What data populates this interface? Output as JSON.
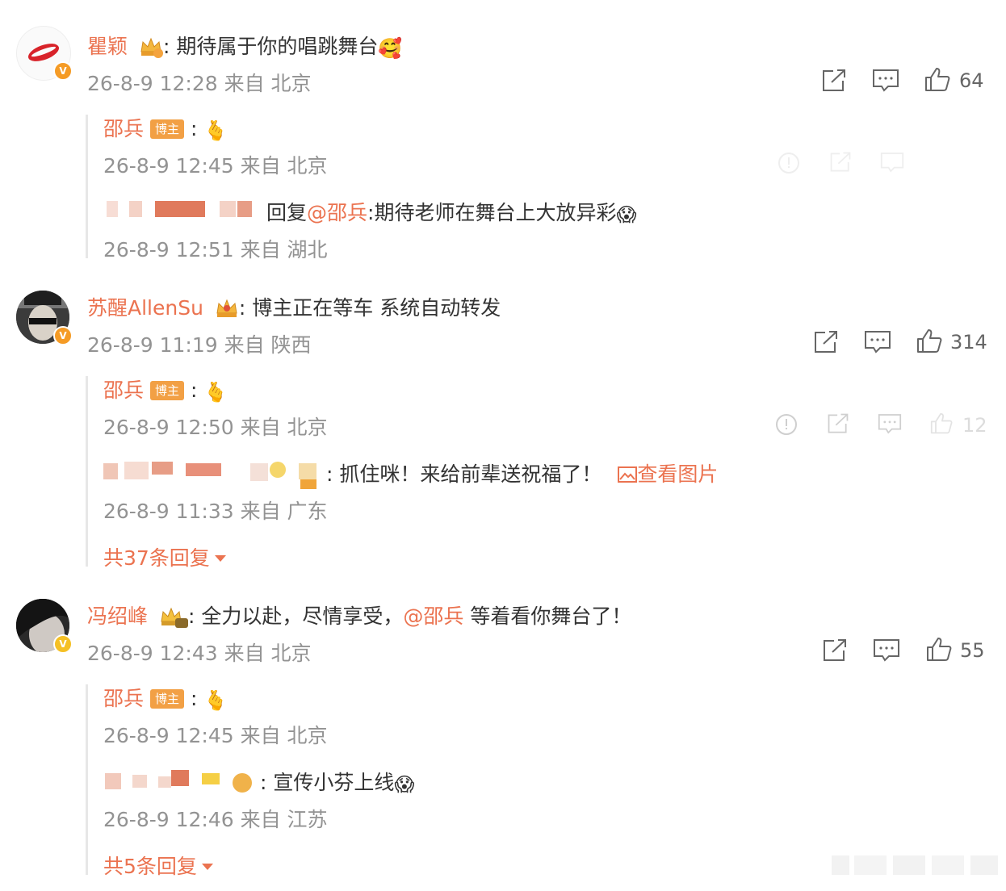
{
  "comments": [
    {
      "user": "瞿颖",
      "text": "期待属于你的唱跳舞台",
      "meta": "26-8-9 12:28 来自 北京",
      "likes": "64",
      "crown_level": "5",
      "badge_color": "#f59b25",
      "replies": [
        {
          "user": "邵兵",
          "tag": "博主",
          "meta": "26-8-9 12:45 来自 北京"
        },
        {
          "prefix": "回复",
          "mention": "@邵兵",
          "text": ":期待老师在舞台上大放异彩",
          "meta": "26-8-9 12:51 来自 湖北"
        }
      ]
    },
    {
      "user": "苏醒AllenSu",
      "text": "博主正在等车 系统自动转发",
      "meta": "26-8-9 11:19 来自 陕西",
      "likes": "314",
      "badge_color": "#f59b25",
      "replies": [
        {
          "user": "邵兵",
          "tag": "博主",
          "meta": "26-8-9 12:50 来自 北京",
          "likes": "12"
        },
        {
          "text": "抓住咪！来给前辈送祝福了！",
          "image_link": "查看图片",
          "meta": "26-8-9 11:33 来自 广东"
        }
      ],
      "more": "共37条回复"
    },
    {
      "user": "冯绍峰",
      "text_before": "全力以赴，尽情享受，",
      "mention": "@邵兵",
      "text_after": " 等着看你舞台了！",
      "meta": "26-8-9 12:43 来自 北京",
      "likes": "55",
      "crown_level": "10",
      "badge_color": "#f5c025",
      "replies": [
        {
          "user": "邵兵",
          "tag": "博主",
          "meta": "26-8-9 12:45 来自 北京"
        },
        {
          "text": "宣传小芬上线",
          "meta": "26-8-9 12:46 来自 江苏"
        }
      ],
      "more": "共5条回复"
    }
  ],
  "icons": {
    "share": "share-icon",
    "comment": "comment-icon",
    "like": "like-icon",
    "report": "report-icon"
  }
}
